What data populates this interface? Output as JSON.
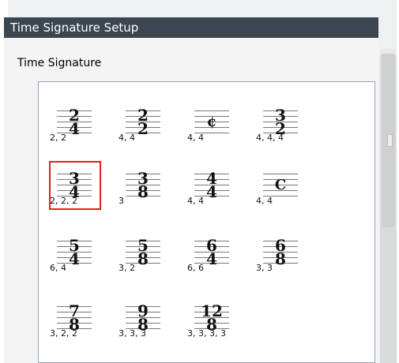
{
  "dialog": {
    "title": "Time Signature Setup",
    "section_label": "Time Signature"
  },
  "colors": {
    "title_bg": "#3b4650",
    "selection": "#e0201b"
  },
  "selected_index": 4,
  "time_signatures": [
    {
      "numerator": "2",
      "denominator": "4",
      "symbol": "",
      "grouping": "2, 2"
    },
    {
      "numerator": "2",
      "denominator": "2",
      "symbol": "",
      "grouping": "4, 4"
    },
    {
      "numerator": "",
      "denominator": "",
      "symbol": "¢",
      "grouping": "4, 4"
    },
    {
      "numerator": "3",
      "denominator": "2",
      "symbol": "",
      "grouping": "4, 4, 4"
    },
    {
      "numerator": "3",
      "denominator": "4",
      "symbol": "",
      "grouping": "2, 2, 2"
    },
    {
      "numerator": "3",
      "denominator": "8",
      "symbol": "",
      "grouping": "3"
    },
    {
      "numerator": "4",
      "denominator": "4",
      "symbol": "",
      "grouping": "4, 4"
    },
    {
      "numerator": "",
      "denominator": "",
      "symbol": "C",
      "grouping": "4, 4"
    },
    {
      "numerator": "5",
      "denominator": "4",
      "symbol": "",
      "grouping": "6, 4"
    },
    {
      "numerator": "5",
      "denominator": "8",
      "symbol": "",
      "grouping": "3, 2"
    },
    {
      "numerator": "6",
      "denominator": "4",
      "symbol": "",
      "grouping": "6, 6"
    },
    {
      "numerator": "6",
      "denominator": "8",
      "symbol": "",
      "grouping": "3, 3"
    },
    {
      "numerator": "7",
      "denominator": "8",
      "symbol": "",
      "grouping": "3, 2, 2"
    },
    {
      "numerator": "9",
      "denominator": "8",
      "symbol": "",
      "grouping": "3, 3, 3"
    },
    {
      "numerator": "12",
      "denominator": "8",
      "symbol": "",
      "grouping": "3, 3, 3, 3"
    }
  ]
}
